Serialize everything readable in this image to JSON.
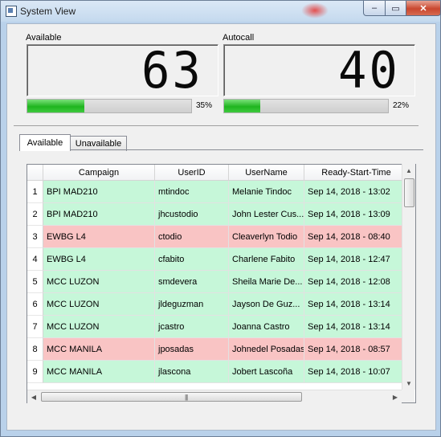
{
  "window": {
    "title": "System View",
    "buttons": {
      "minimize": "‒",
      "maximize": "▭",
      "close": "✕"
    }
  },
  "metrics": [
    {
      "label": "Available",
      "value": "63",
      "percent_text": "35%",
      "progress": 0.35
    },
    {
      "label": "Autocall",
      "value": "40",
      "percent_text": "22%",
      "progress": 0.22
    }
  ],
  "tabs": [
    {
      "label": "Available",
      "active": true
    },
    {
      "label": "Unavailable",
      "active": false
    }
  ],
  "table": {
    "columns": [
      "Campaign",
      "UserID",
      "UserName",
      "Ready-Start-Time"
    ],
    "rows": [
      {
        "num": "1",
        "campaign": "BPI MAD210",
        "userid": "mtindoc",
        "username": "Melanie Tindoc",
        "ready": "Sep 14, 2018 - 13:02",
        "status": "available"
      },
      {
        "num": "2",
        "campaign": "BPI MAD210",
        "userid": "jhcustodio",
        "username": "John Lester Cus...",
        "ready": "Sep 14, 2018 - 13:09",
        "status": "available"
      },
      {
        "num": "3",
        "campaign": "EWBG L4",
        "userid": "ctodio",
        "username": "Cleaverlyn Todio",
        "ready": "Sep 14, 2018 - 08:40",
        "status": "late"
      },
      {
        "num": "4",
        "campaign": "EWBG L4",
        "userid": "cfabito",
        "username": "Charlene Fabito",
        "ready": "Sep 14, 2018 - 12:47",
        "status": "available"
      },
      {
        "num": "5",
        "campaign": "MCC LUZON",
        "userid": "smdevera",
        "username": "Sheila Marie De...",
        "ready": "Sep 14, 2018 - 12:08",
        "status": "available"
      },
      {
        "num": "6",
        "campaign": "MCC LUZON",
        "userid": "jldeguzman",
        "username": "Jayson De Guz...",
        "ready": "Sep 14, 2018 - 13:14",
        "status": "available"
      },
      {
        "num": "7",
        "campaign": "MCC LUZON",
        "userid": "jcastro",
        "username": "Joanna Castro",
        "ready": "Sep 14, 2018 - 13:14",
        "status": "available"
      },
      {
        "num": "8",
        "campaign": "MCC MANILA",
        "userid": "jposadas",
        "username": "Johnedel Posadas",
        "ready": "Sep 14, 2018 - 08:57",
        "status": "late"
      },
      {
        "num": "9",
        "campaign": "MCC MANILA",
        "userid": "jlascona",
        "username": "Jobert Lascoña",
        "ready": "Sep 14, 2018 - 10:07",
        "status": "available"
      }
    ]
  },
  "colors": {
    "available_row": "#c6f7d9",
    "late_row": "#f9c4c4",
    "progress_green": "#1fb51f"
  },
  "icons": {
    "scroll_up": "▲",
    "scroll_down": "▼",
    "scroll_left": "◀",
    "scroll_right": "▶",
    "grip": "|||"
  }
}
